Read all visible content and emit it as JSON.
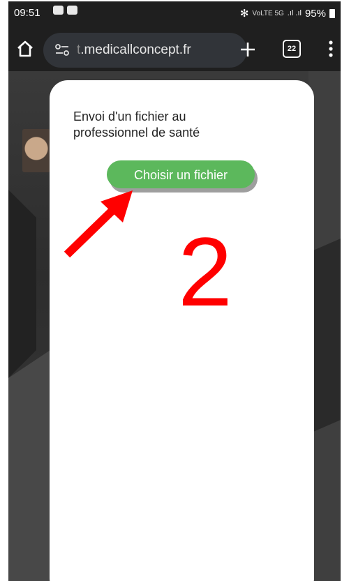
{
  "status_bar": {
    "time": "09:51",
    "network_small": "VoLTE 5G",
    "battery": "95%"
  },
  "browser": {
    "url_prefix": "t",
    "url_main": ".medicallconcept.fr",
    "tab_count": "22"
  },
  "modal": {
    "title": "Envoi d'un fichier au professionnel de santé",
    "choose_button": "Choisir un fichier"
  },
  "annotation": {
    "step": "2"
  },
  "colors": {
    "button_green": "#5cb85c",
    "annotation_red": "#ff0000",
    "browser_dark": "#1f1f1f"
  }
}
